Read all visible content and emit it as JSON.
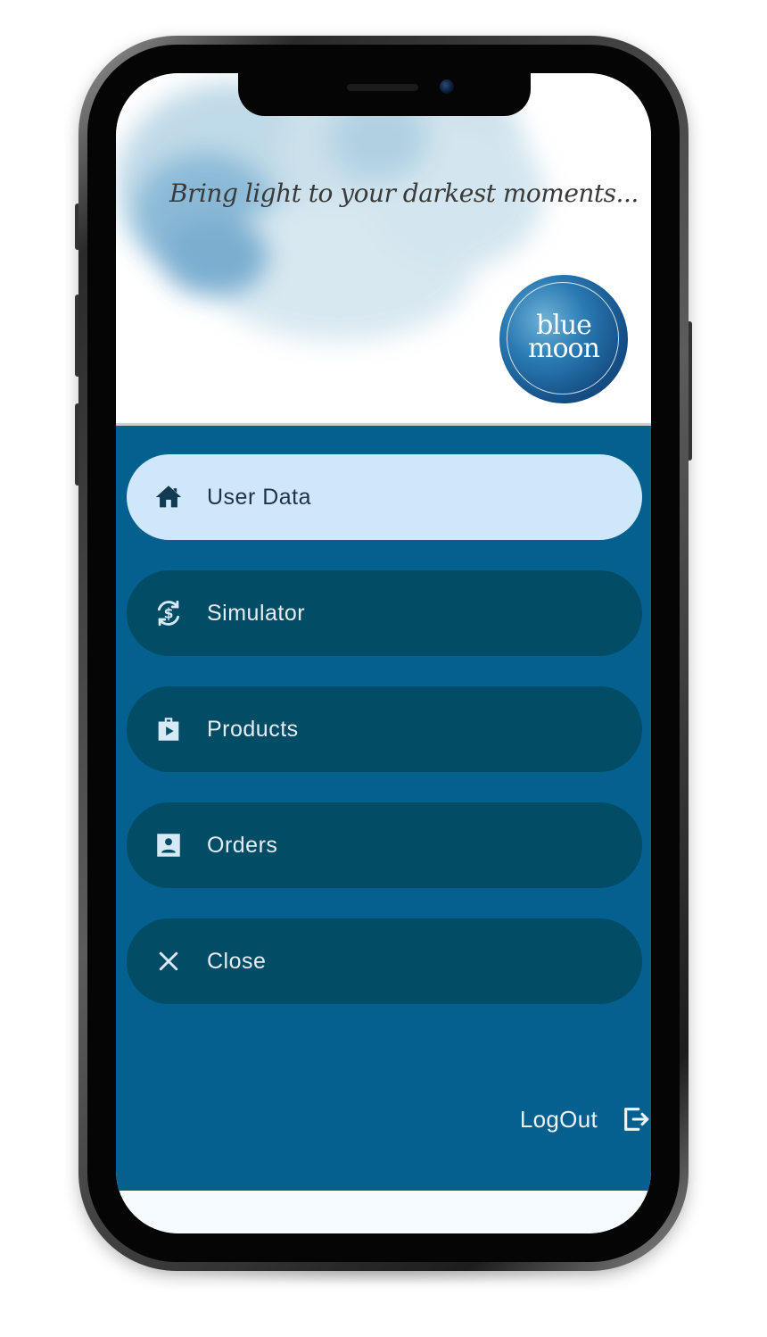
{
  "header": {
    "tagline": "Bring light to your darkest moments...",
    "logo": {
      "line1": "blue",
      "line2": "moon"
    }
  },
  "drawer": {
    "items": [
      {
        "label": "User Data",
        "icon": "home-icon",
        "active": true
      },
      {
        "label": "Simulator",
        "icon": "currency-exchange-icon",
        "active": false
      },
      {
        "label": "Products",
        "icon": "shop-bag-icon",
        "active": false
      },
      {
        "label": "Orders",
        "icon": "contact-card-icon",
        "active": false
      },
      {
        "label": "Close",
        "icon": "close-icon",
        "active": false
      }
    ],
    "logout": {
      "label": "LogOut",
      "icon": "logout-icon"
    }
  },
  "colors": {
    "drawer_bg": "#03608f",
    "item_bg": "#034c65",
    "active_item_bg": "#cfe7fb"
  }
}
